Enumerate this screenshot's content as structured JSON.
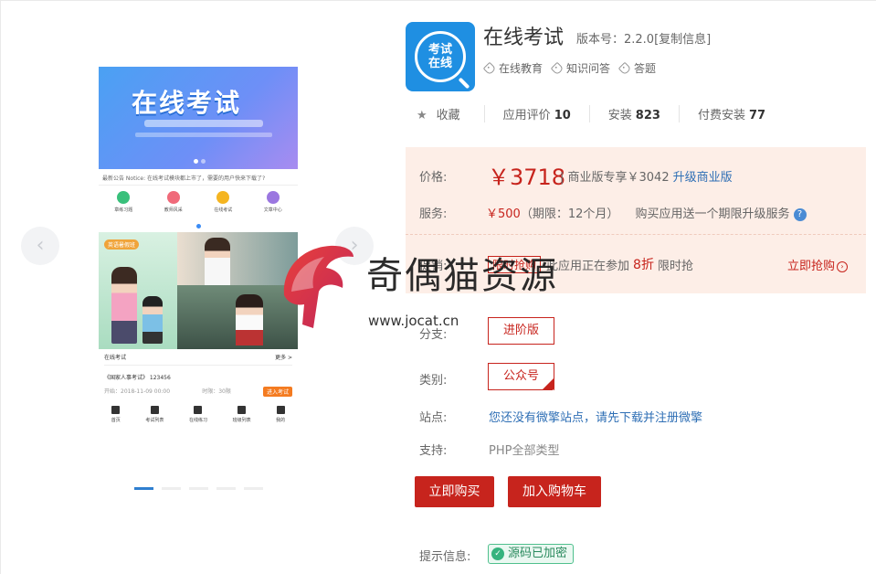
{
  "gallery": {
    "prev_arrow": "‹",
    "next_arrow": "›",
    "phone": {
      "banner_title": "在线考试",
      "notice": "最新公告 Notice: 在线考试模块都上市了，需要的用户快来下载了?",
      "nav": [
        "章练习题",
        "教师风采",
        "在线考试",
        "文章中心"
      ],
      "promo_tag": "英语暑假班",
      "exam_header": "在线考试",
      "exam_more": "更多 >",
      "exam_name": "《国家人事考试》 123456",
      "exam_time": "开始：2018-11-09 00:00",
      "exam_duration": "时限：30限",
      "exam_btn": "进入考试",
      "tabbar": [
        "首页",
        "考试列表",
        "在线练习",
        "班级列表",
        "我的"
      ]
    }
  },
  "app": {
    "icon_text_1": "考试",
    "icon_text_2": "在线",
    "title": "在线考试",
    "version": "版本号：2.2.0[复制信息]",
    "tags": [
      "在线教育",
      "知识问答",
      "答题"
    ]
  },
  "stats": {
    "favorite_label": "收藏",
    "rating_label": "应用评价",
    "rating_value": "10",
    "install_label": "安装",
    "install_value": "823",
    "paid_label": "付费安装",
    "paid_value": "77"
  },
  "pricing": {
    "price_label": "价格:",
    "price": "￥3718",
    "commercial_text": "| 商业版专享￥3042",
    "upgrade_link": "升级商业版",
    "service_label": "服务:",
    "service_price": "￥500",
    "service_period": "（期限：12个月）",
    "service_note": "购买应用送一个期限升级服务",
    "service_help": "?",
    "promo_label": "促销:",
    "promo_badge": "限时抢购",
    "promo_text": "此应用正在参加",
    "promo_discount": "8折",
    "promo_suffix": "限时抢",
    "buy_now_link": "立即抢购"
  },
  "options": {
    "branch_label": "分支:",
    "branch_value": "进阶版",
    "category_label": "类别:",
    "category_value": "公众号",
    "site_label": "站点:",
    "site_value": "您还没有微擎站点，请先下载并注册微擎",
    "support_label": "支持:",
    "support_value": "PHP全部类型"
  },
  "actions": {
    "buy_now": "立即购买",
    "add_cart": "加入购物车"
  },
  "hint": {
    "label": "提示信息:",
    "badge": "源码已加密"
  },
  "watermark": {
    "text": "奇偶猫资源",
    "url": "www.jocat.cn"
  },
  "colors": {
    "accent": "#c7241d",
    "link": "#2f6fb5",
    "price_bg": "#fdeee7"
  }
}
